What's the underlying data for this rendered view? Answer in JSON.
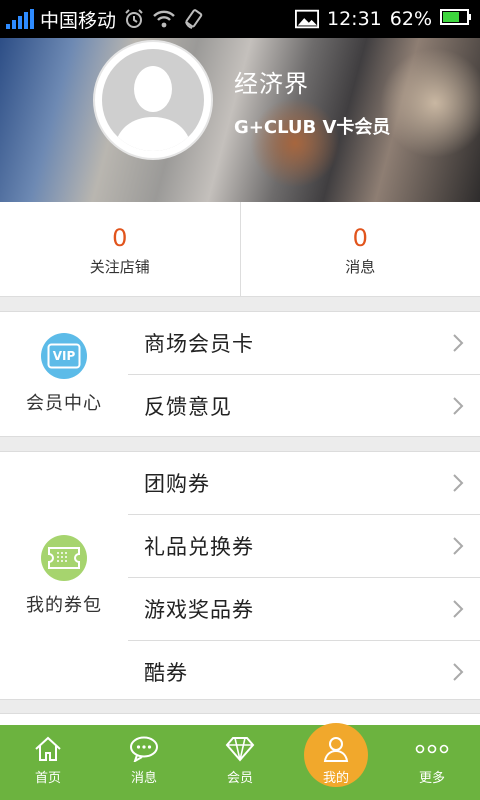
{
  "status_bar": {
    "carrier": "中国移动",
    "time": "12:31",
    "battery": "62%",
    "icons": [
      "signal-icon",
      "alarm-icon",
      "wifi-icon",
      "rotate-icon",
      "image-icon",
      "battery-icon"
    ]
  },
  "profile": {
    "name": "经济界",
    "membership": "G+CLUB V卡会员"
  },
  "stats": [
    {
      "count": "0",
      "label": "关注店铺"
    },
    {
      "count": "0",
      "label": "消息"
    }
  ],
  "member_center": {
    "label": "会员中心",
    "icon": "vip-card-icon",
    "icon_text": "VIP",
    "items": [
      {
        "label": "商场会员卡"
      },
      {
        "label": "反馈意见"
      }
    ]
  },
  "coupon_wallet": {
    "label": "我的券包",
    "icon": "ticket-icon",
    "items": [
      {
        "label": "团购券"
      },
      {
        "label": "礼品兑换券"
      },
      {
        "label": "游戏奖品券"
      },
      {
        "label": "酷券"
      }
    ]
  },
  "tabs": [
    {
      "label": "首页",
      "icon": "home-icon"
    },
    {
      "label": "消息",
      "icon": "chat-icon"
    },
    {
      "label": "会员",
      "icon": "diamond-icon"
    },
    {
      "label": "我的",
      "icon": "user-icon",
      "active": true
    },
    {
      "label": "更多",
      "icon": "more-icon"
    }
  ],
  "colors": {
    "accent_green": "#6cb33f",
    "active_tab": "#f1a82c",
    "count_orange": "#e1541c",
    "vip_blue": "#5cbbe8",
    "ticket_green": "#a6d46e"
  }
}
